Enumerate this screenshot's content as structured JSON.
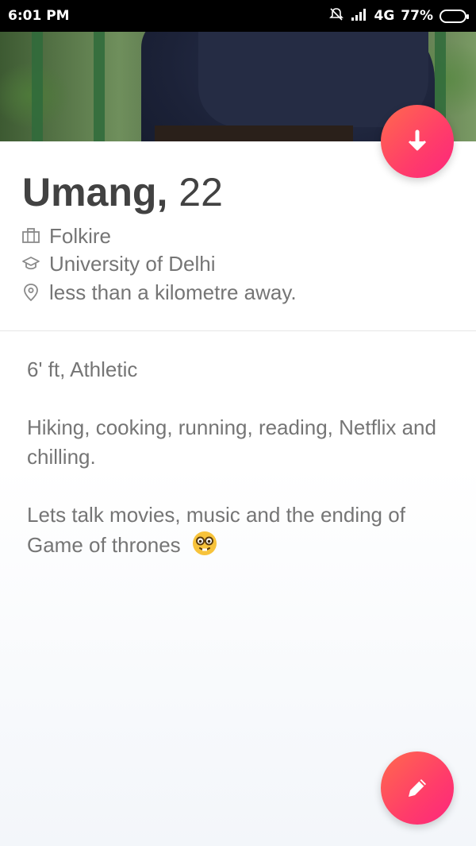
{
  "status_bar": {
    "time": "6:01 PM",
    "network": "4G",
    "battery": "77%",
    "battery_level": 0.77
  },
  "profile": {
    "name": "Umang,",
    "age": "22",
    "job": "Folkire",
    "school": "University of Delhi",
    "distance": "less than a kilometre away."
  },
  "bio": {
    "line1": "6' ft, Athletic",
    "line2": "Hiking, cooking, running, reading, Netflix and chilling.",
    "line3": "Lets talk movies, music and the ending of Game of thrones"
  },
  "icons": {
    "collapse": "arrow-down-icon",
    "edit": "pencil-icon",
    "job": "briefcase-icon",
    "school": "graduation-cap-icon",
    "location": "location-pin-icon",
    "emoji": "nerd-face-emoji"
  },
  "colors": {
    "accent_start": "#ff6a4d",
    "accent_end": "#fd267d",
    "name_text": "#424242",
    "secondary_text": "#757575"
  }
}
